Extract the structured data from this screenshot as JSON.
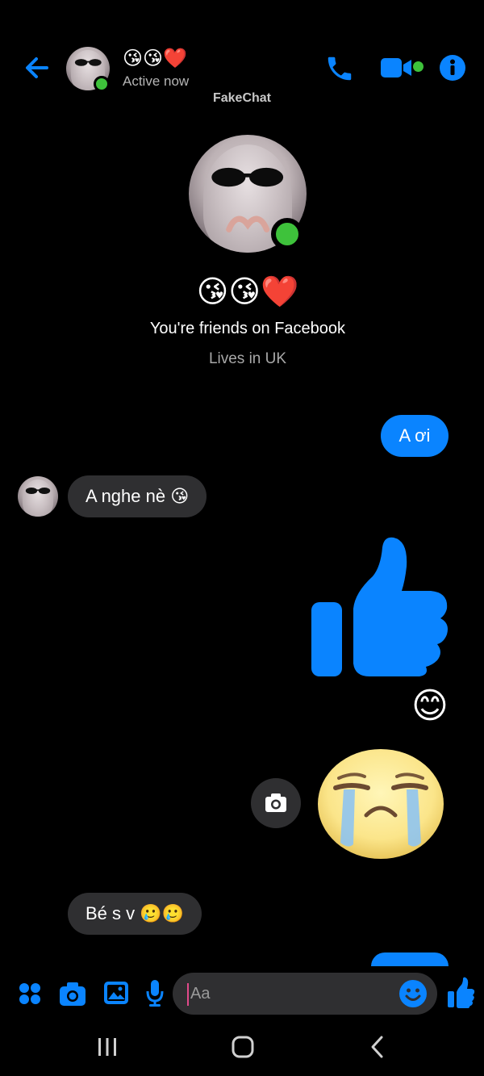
{
  "header": {
    "contact_name_emojis": "😘😘❤️",
    "status": "Active now",
    "app_name": "FakeChat",
    "back_icon": "arrow-left-icon",
    "call_icon": "phone-icon",
    "video_icon": "video-camera-icon",
    "info_icon": "info-icon"
  },
  "profile": {
    "name_emojis": "😘😘❤️",
    "friends_text": "You're friends on Facebook",
    "location": "Lives in UK"
  },
  "messages": [
    {
      "from": "me",
      "text": "A ơi"
    },
    {
      "from": "them",
      "text": "A nghe nè 😘"
    },
    {
      "from": "me",
      "type": "sticker",
      "icon": "thumbs-up-icon"
    },
    {
      "from": "me",
      "type": "emoji",
      "text": "😊"
    },
    {
      "from": "me",
      "type": "sticker",
      "icon": "crying-face-icon"
    },
    {
      "from": "them",
      "text": "Bé s v 🥲🥲"
    }
  ],
  "composer": {
    "placeholder": "Aa",
    "icons": [
      "apps-icon",
      "camera-icon",
      "gallery-icon",
      "mic-icon",
      "emoji-icon",
      "like-icon"
    ]
  },
  "nav": {
    "icons": [
      "recent-apps-icon",
      "home-icon",
      "back-nav-icon"
    ]
  },
  "colors": {
    "accent": "#0a84ff",
    "incoming_bubble": "#2f2f31",
    "online": "#3ec23b",
    "background": "#000000"
  }
}
